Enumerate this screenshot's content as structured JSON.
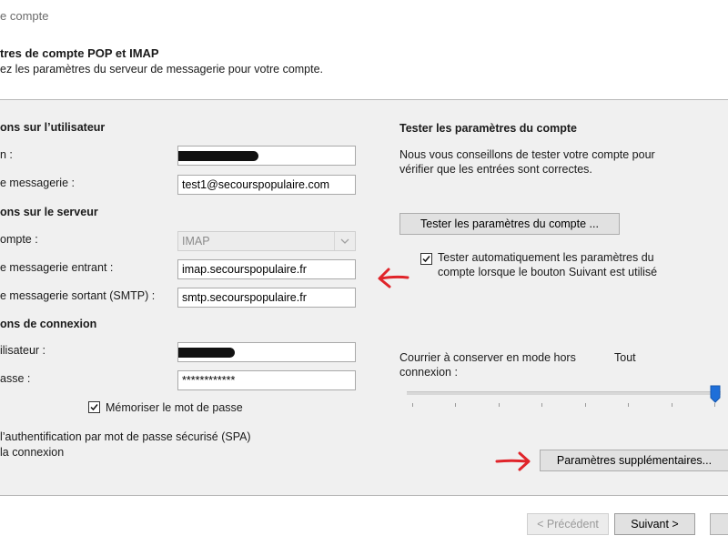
{
  "window": {
    "title": "e compte"
  },
  "header": {
    "title": "tres de compte POP et IMAP",
    "subtitle": "ez les paramètres du serveur de messagerie pour votre compte."
  },
  "user_info": {
    "section": "ons sur l’utilisateur",
    "name_label": "n :",
    "email_label": "e messagerie :",
    "email_value": "test1@secourspopulaire.com"
  },
  "server_info": {
    "section": "ons sur le serveur",
    "account_type_label": "ompte :",
    "account_type_value": "IMAP",
    "incoming_label": "e messagerie entrant :",
    "incoming_value": "imap.secourspopulaire.fr",
    "outgoing_label": "e messagerie sortant (SMTP) :",
    "outgoing_value": "smtp.secourspopulaire.fr"
  },
  "login_info": {
    "section": "ons de connexion",
    "user_label": "ilisateur :",
    "password_label": "asse :",
    "password_value": "************",
    "remember_label": "Mémoriser le mot de passe",
    "remember_checked": true,
    "spa_line1": "l’authentification par mot de passe sécurisé (SPA)",
    "spa_line2": "la connexion"
  },
  "test_settings": {
    "section": "Tester les paramètres du compte",
    "desc_line1": "Nous vous conseillons de tester votre compte pour",
    "desc_line2": "vérifier que les entrées sont correctes.",
    "test_button": "Tester les paramètres du compte ...",
    "auto_test_line1": "Tester automatiquement les paramètres du",
    "auto_test_line2": "compte lorsque le bouton Suivant est utilisé",
    "auto_test_checked": true
  },
  "offline": {
    "label_line1": "Courrier à conserver en mode hors",
    "label_line2": "connexion :",
    "value_label": "Tout",
    "slider_position": 1.0
  },
  "more_settings_button": "Paramètres supplémentaires...",
  "footer": {
    "prev_button": "< Précédent",
    "next_button": "Suivant >"
  },
  "colors": {
    "panel_bg": "#f0f0f0",
    "button_bg": "#e1e1e1",
    "slider_thumb": "#1e6fd9",
    "annotation_arrow": "#e0242a"
  }
}
